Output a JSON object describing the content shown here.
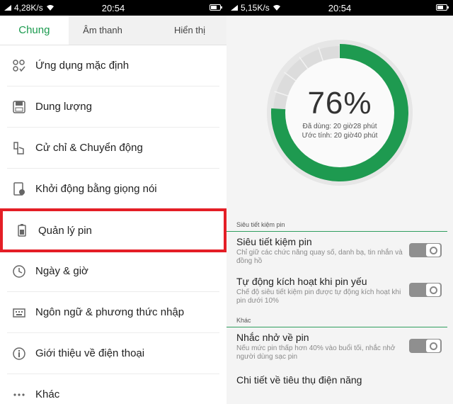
{
  "left": {
    "status": {
      "speed": "4,28K/s",
      "time": "20:54"
    },
    "tabs": [
      {
        "label": "Chung",
        "active": true
      },
      {
        "label": "Âm thanh",
        "active": false
      },
      {
        "label": "Hiển thị",
        "active": false
      }
    ],
    "menu": [
      {
        "label": "Ứng dụng mặc định",
        "icon": "default-apps-icon"
      },
      {
        "label": "Dung lượng",
        "icon": "storage-icon"
      },
      {
        "label": "Cử chỉ & Chuyển động",
        "icon": "gesture-icon"
      },
      {
        "label": "Khởi động bằng giọng nói",
        "icon": "voice-launch-icon"
      },
      {
        "label": "Quản lý pin",
        "icon": "battery-icon",
        "highlighted": true
      },
      {
        "label": "Ngày & giờ",
        "icon": "clock-icon"
      },
      {
        "label": "Ngôn ngữ & phương thức nhập",
        "icon": "keyboard-icon"
      },
      {
        "label": "Giới thiệu về điện thoại",
        "icon": "info-icon"
      },
      {
        "label": "Khác",
        "icon": "more-icon"
      }
    ]
  },
  "right": {
    "status": {
      "speed": "5,15K/s",
      "time": "20:54"
    },
    "gauge": {
      "percent_text": "76%",
      "percent_value": 76,
      "used": "Đã dùng: 20 giờ28 phút",
      "estimate": "Ước tính: 20 giờ40 phút"
    },
    "sections": {
      "saver_head": "Siêu tiết kiệm pin",
      "other_head": "Khác"
    },
    "settings": [
      {
        "title": "Siêu tiết kiệm pin",
        "desc": "Chỉ giữ các chức năng quay số, danh bạ, tin nhắn và đồng hồ",
        "on": false
      },
      {
        "title": "Tự động kích hoạt khi pin yếu",
        "desc": "Chế độ siêu tiết kiệm pin được tự động kích hoạt khi pin dưới 10%",
        "on": false
      },
      {
        "title": "Nhắc nhở về pin",
        "desc": "Nếu mức pin thấp hơn 40% vào buổi tối, nhắc nhở người dùng sạc pin",
        "on": false
      }
    ],
    "details_link": "Chi tiết về tiêu thụ điện năng"
  },
  "colors": {
    "accent": "#1a9a4e",
    "gauge_green": "#1e9a50",
    "highlight": "#e41e26"
  }
}
